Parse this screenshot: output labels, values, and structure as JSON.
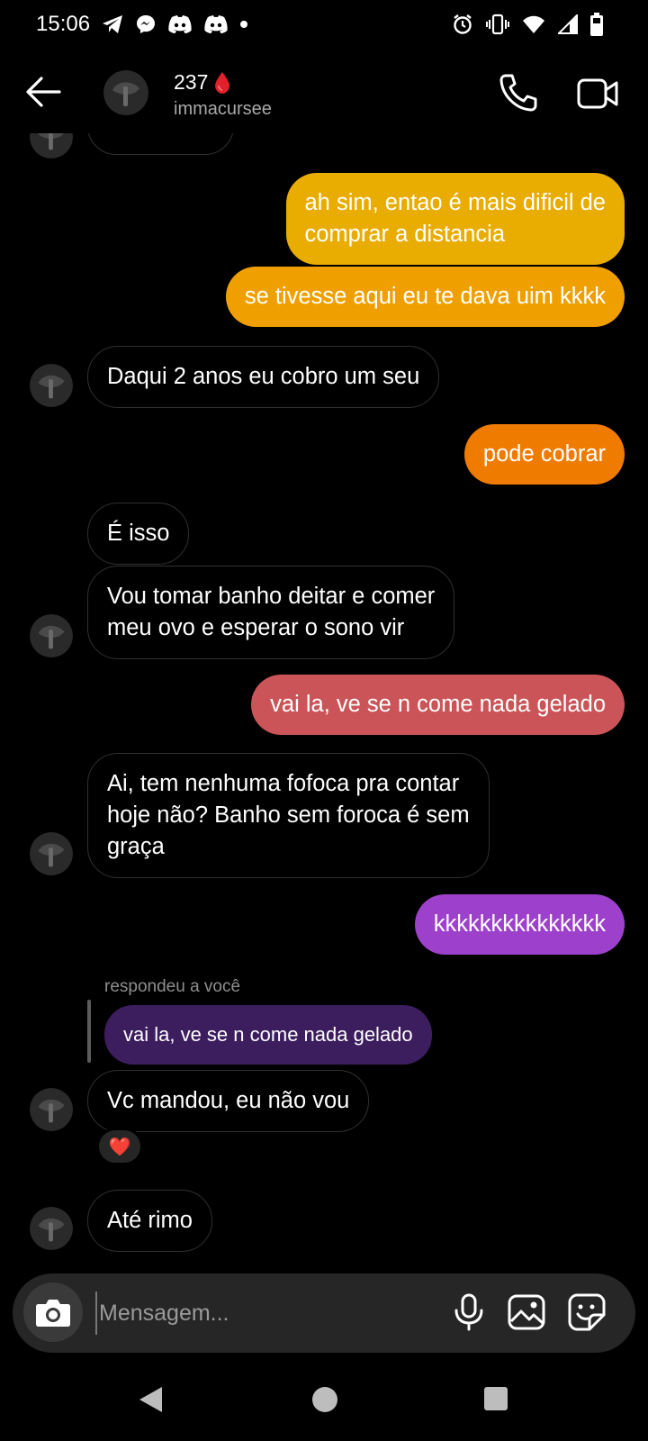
{
  "status_bar": {
    "time": "15:06",
    "left_icons": [
      "telegram-icon",
      "messenger-icon",
      "discord-icon",
      "discord-icon",
      "dot-icon"
    ],
    "right_icons": [
      "alarm-icon",
      "vibrate-icon",
      "wifi-icon",
      "signal-icon",
      "battery-icon"
    ]
  },
  "header": {
    "name": "237",
    "name_emoji": "blood-drop-icon",
    "handle": "immacursee"
  },
  "messages": [
    {
      "id": "m1",
      "direction": "out",
      "text": "ah sim, entao é mais dificil de\ncomprar a distancia",
      "color": "#E9AC00"
    },
    {
      "id": "m2",
      "direction": "out",
      "text": "se tivesse aqui eu te dava uim kkkk",
      "color": "#EFA000"
    },
    {
      "id": "m3",
      "direction": "in",
      "text": "Daqui 2 anos eu cobro um seu"
    },
    {
      "id": "m4",
      "direction": "out",
      "text": "pode cobrar",
      "color": "#EF7B00"
    },
    {
      "id": "m5",
      "direction": "in",
      "text": "É isso"
    },
    {
      "id": "m6",
      "direction": "in",
      "text": "Vou tomar banho deitar e comer\nmeu ovo e esperar o sono vir"
    },
    {
      "id": "m7",
      "direction": "out",
      "text": "vai la, ve se n come nada gelado",
      "color": "#CA5457"
    },
    {
      "id": "m8",
      "direction": "in",
      "text": "Ai, tem nenhuma fofoca pra contar\nhoje não? Banho sem foroca é sem\ngraça"
    },
    {
      "id": "m9",
      "direction": "out",
      "text": "kkkkkkkkkkkkkkk",
      "color": "#9D41CC"
    },
    {
      "id": "m10",
      "direction": "in",
      "text": "Vc mandou, eu não vou",
      "reply_label": "respondeu a você",
      "reply_quote": "vai la, ve se n come nada gelado",
      "reaction": "❤️"
    },
    {
      "id": "m11",
      "direction": "in",
      "text": "Até rimo"
    }
  ],
  "composer": {
    "placeholder": "Mensagem..."
  }
}
